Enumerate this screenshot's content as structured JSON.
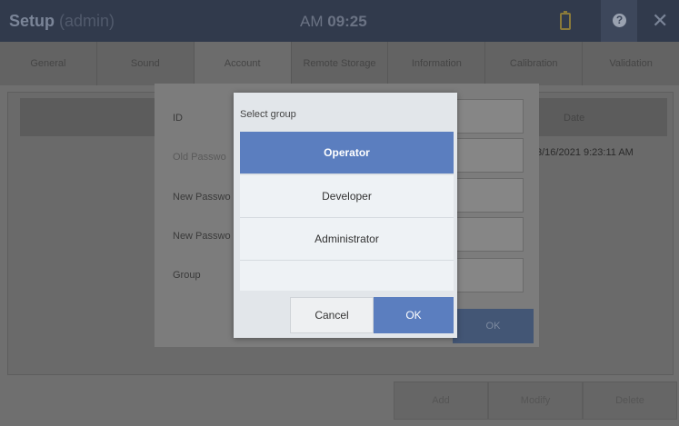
{
  "window": {
    "title": "Setup",
    "title_sub": "(admin)",
    "clock_ampm": "AM",
    "clock_time": "09:25"
  },
  "tabs": [
    "General",
    "Sound",
    "Account",
    "Remote Storage",
    "Information",
    "Calibration",
    "Validation"
  ],
  "active_tab": "Account",
  "table": {
    "date_header": "Date",
    "row_date": "3/16/2021 9:23:11 AM"
  },
  "bottom_buttons": [
    "Add",
    "Modify",
    "Delete"
  ],
  "account_dialog": {
    "labels": [
      "ID",
      "Old Passwo",
      "New Passwo",
      "New Passwo",
      "Group"
    ],
    "ok_label": "OK"
  },
  "select_group": {
    "title": "Select group",
    "options": [
      "Operator",
      "Developer",
      "Administrator",
      ""
    ],
    "selected": "Operator",
    "cancel_label": "Cancel",
    "ok_label": "OK"
  },
  "colors": {
    "accent": "#5b7ebf",
    "topbar": "#313a4c"
  },
  "icons": [
    "battery-icon",
    "help-icon",
    "close-icon"
  ]
}
